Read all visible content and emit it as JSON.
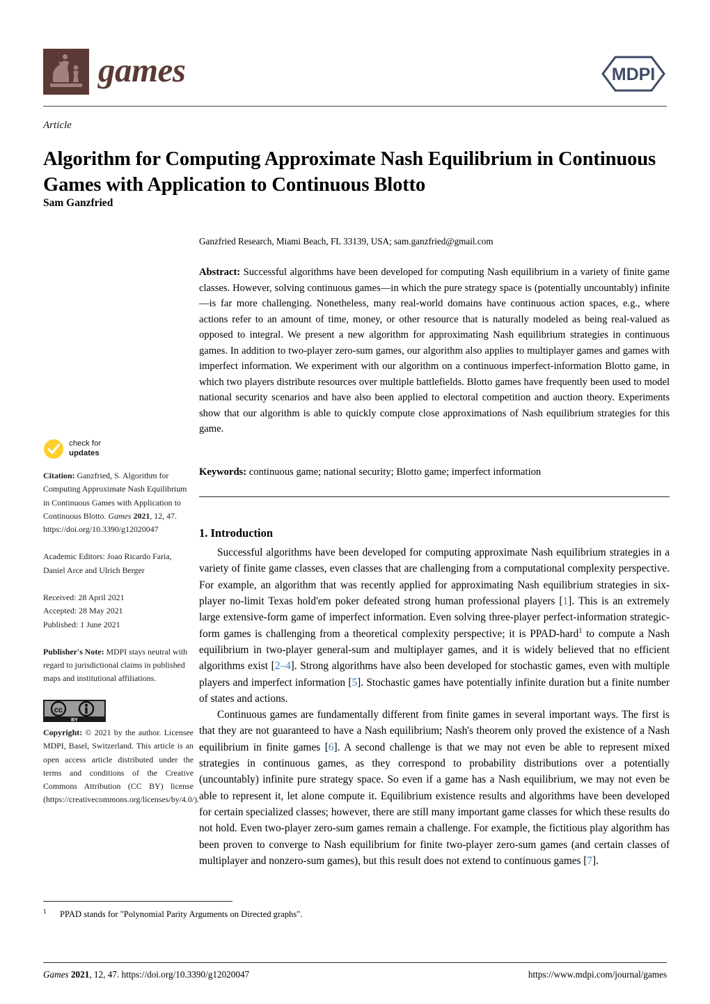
{
  "masthead": {
    "journal_name": "games",
    "publisher_logo_text": "MDPI",
    "logo_icon": "chess-pieces-icon"
  },
  "header": {
    "article_type": "Article",
    "title": "Algorithm for Computing Approximate Nash Equilibrium in Continuous Games with Application to Continuous Blotto",
    "author": "Sam Ganzfried",
    "affiliation": "Ganzfried Research, Miami Beach, FL 33139, USA; sam.ganzfried@gmail.com"
  },
  "abstract": {
    "label": "Abstract:",
    "text": "Successful algorithms have been developed for computing Nash equilibrium in a variety of finite game classes. However, solving continuous games—in which the pure strategy space is (potentially uncountably) infinite—is far more challenging. Nonetheless, many real-world domains have continuous action spaces, e.g., where actions refer to an amount of time, money, or other resource that is naturally modeled as being real-valued as opposed to integral. We present a new algorithm for approximating Nash equilibrium strategies in continuous games. In addition to two-player zero-sum games, our algorithm also applies to multiplayer games and games with imperfect information. We experiment with our algorithm on a continuous imperfect-information Blotto game, in which two players distribute resources over multiple battlefields. Blotto games have frequently been used to model national security scenarios and have also been applied to electoral competition and auction theory. Experiments show that our algorithm is able to quickly compute close approximations of Nash equilibrium strategies for this game."
  },
  "keywords": {
    "label": "Keywords:",
    "text": "continuous game; national security; Blotto game; imperfect information"
  },
  "section": {
    "heading": "1. Introduction",
    "paragraph_1_a": "Successful algorithms have been developed for computing approximate Nash equilibrium strategies in a variety of finite game classes, even classes that are challenging from a computational complexity perspective. For example, an algorithm that was recently applied for approximating Nash equilibrium strategies in six-player no-limit Texas hold'em poker defeated strong human professional players [",
    "ref_1": "1",
    "paragraph_1_b": "]. This is an extremely large extensive-form game of imperfect information. Even solving three-player perfect-information strategic-form games is challenging from a theoretical complexity perspective; it is PPAD-hard",
    "footnote_marker": "1",
    "paragraph_1_c": " to compute a Nash equilibrium in two-player general-sum and multiplayer games, and it is widely believed that no efficient algorithms exist [",
    "ref_2": "2–4",
    "paragraph_1_d": "]. Strong algorithms have also been developed for stochastic games, even with multiple players and imperfect information [",
    "ref_3": "5",
    "paragraph_1_e": "]. Stochastic games have potentially infinite duration but a finite number of states and actions.",
    "paragraph_2_a": "Continuous games are fundamentally different from finite games in several important ways. The first is that they are not guaranteed to have a Nash equilibrium; Nash's theorem only proved the existence of a Nash equilibrium in finite games [",
    "ref_4": "6",
    "paragraph_2_b": "]. A second challenge is that we may not even be able to represent mixed strategies in continuous games, as they correspond to probability distributions over a potentially (uncountably) infinite pure strategy space. So even if a game has a Nash equilibrium, we may not even be able to represent it, let alone compute it. Equilibrium existence results and algorithms have been developed for certain specialized classes; however, there are still many important game classes for which these results do not hold. Even two-player zero-sum games remain a challenge. For example, the fictitious play algorithm has been proven to converge to Nash equilibrium for finite two-player zero-sum games (and certain classes of multiplayer and nonzero-sum games), but this result does not extend to continuous games [",
    "ref_5": "7",
    "paragraph_2_c": "]."
  },
  "sidebar": {
    "updates_badge_line1": "check for",
    "updates_badge_line2": "updates",
    "updates_icon": "check-circle-icon",
    "citation_label": "Citation:",
    "citation_text_a": " Ganzfried, S. Algorithm for Computing Approximate Nash Equilibrium in Continuous Games with Application to Continuous Blotto. ",
    "citation_journal": "Games",
    "citation_year": "2021",
    "citation_text_b": ", 12, 47. https://doi.org/10.3390/g12020047",
    "academic_editors": "Academic Editors: Joao Ricardo Faria, Daniel Arce and Ulrich Berger",
    "received": "Received: 28 April 2021",
    "accepted": "Accepted: 28 May 2021",
    "published": "Published: 1 June 2021",
    "publisher_note_label": "Publisher's Note:",
    "publisher_note_text": " MDPI stays neutral with regard to jurisdictional claims in published maps and institutional affiliations.",
    "cc_icon": "creative-commons-by-icon",
    "copyright_label": "Copyright:",
    "copyright_text": " © 2021 by the author. Licensee MDPI, Basel, Switzerland. This article is an open access article distributed under the terms and conditions of the Creative Commons Attribution (CC BY) license (https://creativecommons.org/licenses/by/4.0/)."
  },
  "footnote": {
    "marker": "1",
    "text": "PPAD stands for \"Polynomial Parity Arguments on Directed graphs\"."
  },
  "footer": {
    "left_journal": "Games",
    "left_year": "2021",
    "left_rest": ", 12, 47. https://doi.org/10.3390/g12020047",
    "right": "https://www.mdpi.com/journal/games"
  },
  "colors": {
    "brand_brown": "#5b3a35",
    "mdpi_navy": "#3f4a67",
    "citation_blue": "#2e7fc1",
    "badge_yellow": "#fccf2f"
  }
}
